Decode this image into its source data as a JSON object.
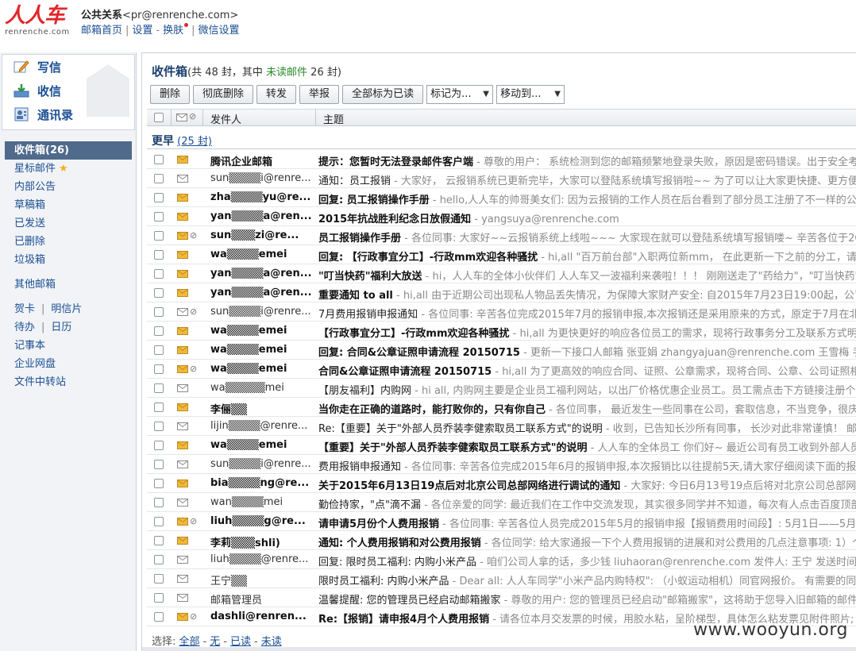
{
  "header": {
    "logo_text": "人人车",
    "logo_sub": "renrenche.com",
    "account_name": "公共关系",
    "account_email": "<pr@renrenche.com>",
    "links": [
      "邮箱首页",
      "设置",
      "换肤",
      "微信设置"
    ]
  },
  "sidebar": {
    "compose": "写信",
    "receive": "收信",
    "contacts": "通讯录",
    "folders": {
      "inbox": "收件箱(26)",
      "starred": "星标邮件",
      "notice": "内部公告",
      "drafts": "草稿箱",
      "sent": "已发送",
      "deleted": "已删除",
      "spam": "垃圾箱",
      "other": "其他邮箱",
      "card": "贺卡",
      "postcard": "明信片",
      "todo": "待办",
      "calendar": "日历",
      "notes": "记事本",
      "netdisk": "企业网盘",
      "transfer": "文件中转站"
    }
  },
  "main": {
    "title": "收件箱",
    "count_prefix": "(共 48 封，其中 ",
    "unread_label": "未读邮件",
    "count_suffix": " 26 封)",
    "toolbar": {
      "delete": "删除",
      "delete_forever": "彻底删除",
      "forward": "转发",
      "report": "举报",
      "mark_all_read": "全部标为已读",
      "mark_as": "标记为...",
      "move_to": "移动到..."
    },
    "columns": {
      "sender": "发件人",
      "subject": "主题"
    },
    "group": {
      "label": "更早",
      "count": "(25 封)"
    },
    "emails": [
      {
        "from": "腾讯企业邮箱",
        "subject": "提示：您暂时无法登录邮件客户端",
        "preview": " - 尊敬的用户： 系统检测到您的邮箱频繁地登录失败，原因是密码错误。出于安全考虑，您",
        "unread": true,
        "attach": false,
        "blue": true
      },
      {
        "from": "sun▒▒▒▒i@renre...",
        "subject": "通知：员工报销",
        "preview": " - 大家好， 云报销系统已更新完毕，大家可以登陆系统填写报销啦~~ 为了可以让大家更快捷、更方便的申请报",
        "unread": false,
        "attach": false
      },
      {
        "from": "zha▒▒▒▒yu@re...",
        "subject": "回复: 员工报销操作手册",
        "preview": " - hello,人人车的帅哥美女们: 因为云报销的工作人员在后台看到了部分员工注册了不一样的公司名称",
        "unread": true,
        "attach": false
      },
      {
        "from": "yan▒▒▒▒a@ren...",
        "subject": "2015年抗战胜利纪念日放假通知",
        "preview": " - yangsuya@renrenche.com",
        "unread": true,
        "attach": false
      },
      {
        "from": "sun▒▒▒zi@re...",
        "subject": "员工报销操作手册",
        "preview": " - 各位同事: 大家好~~云报销系统上线啦~~~ 大家现在就可以登陆系统填写报销喽~ 辛苦各位于2015.0",
        "unread": true,
        "attach": true
      },
      {
        "from": "wa▒▒▒▒emei",
        "subject": "回复: 【行政事宜分工】-行政mm欢迎各种骚扰",
        "preview": " - hi,all \"百万前台部\"入职两位新mm， 在此更新一下之前的分工，请相关",
        "unread": true,
        "attach": false
      },
      {
        "from": "yan▒▒▒▒a@ren...",
        "subject": "\"叮当快药\"福利大放送",
        "preview": " - hi，人人车的全体小伙伴们 人人车又一波福利来袭啦！！！ 刚刚送走了\"药给力\"，\"叮当快药\"又来给",
        "unread": true,
        "attach": false
      },
      {
        "from": "yan▒▒▒▒a@ren...",
        "subject": "重要通知 to all",
        "preview": " - hi,all 由于近期公司出现私人物品丢失情况，为保障大家财产安全: 自2015年7月23日19:00起，公司将随",
        "unread": true,
        "attach": false
      },
      {
        "from": "sun▒▒▒▒i@renre...",
        "subject": "7月费用报销申报通知",
        "preview": " - 各位同事: 辛苦各位完成2015年7月的报销申报,本次报销还是采用原来的方式，原定于7月在北京上线",
        "unread": false,
        "attach": true
      },
      {
        "from": "wa▒▒▒▒emei",
        "subject": "【行政事宜分工】-行政mm欢迎各种骚扰",
        "preview": " - hi,all 为更快更好的响应各位员工的需求，现将行政事务分工及联系方式明确如下",
        "unread": true,
        "attach": false
      },
      {
        "from": "wa▒▒▒▒emei",
        "subject": "回复: 合同&公章证照申请流程 20150715",
        "preview": " - 更新一下接口人邮箱 张亚娟 zhangyajuan@renrenche.com 王雪梅 手机：1",
        "unread": true,
        "attach": false
      },
      {
        "from": "wa▒▒▒▒emei",
        "subject": "合同&公章证照申请流程 20150715",
        "preview": " - hi,all 为了更高效的响应合同、证照、公章需求，现将合同、公章、公司证照相关申请",
        "unread": true,
        "attach": true
      },
      {
        "from": "wa▒▒▒▒▒mei",
        "subject": "【朋友福利】内购网",
        "preview": " - hi all, 内购网主要是企业员工福利网站，以出厂价格优惠企业员工。员工需点击下方链接注册个人账号，",
        "unread": false,
        "attach": false
      },
      {
        "from": "李俪▒▒",
        "subject": "当你走在正确的道路时，能打败你的，只有你自己",
        "preview": " - 各位同事， 最近发生一些同事在公司，套取信息，不当竞争，很庆幸我们",
        "unread": true,
        "attach": false
      },
      {
        "from": "lijin▒▒▒▒@renre...",
        "subject": "Re:【重要】关于\"外部人员乔装李健索取员工联系方式\"的说明",
        "preview": " - 收到，已告知长沙所有同事， 长沙对此非常谨慎！ 邮件自认",
        "unread": false,
        "attach": false
      },
      {
        "from": "wa▒▒▒▒emei",
        "subject": "【重要】关于\"外部人员乔装李健索取员工联系方式\"的说明",
        "preview": " - 人人车的全体员工 你们好~ 最近公司有员工收到外部人员邮件",
        "unread": true,
        "attach": false
      },
      {
        "from": "sun▒▒▒▒i@renre...",
        "subject": "费用报销申报通知",
        "preview": " - 各位同事: 辛苦各位完成2015年6月的报销申报,本次报销比以往提前5天,请大家仔细阅读下面的报销说明",
        "unread": false,
        "attach": false
      },
      {
        "from": "bia▒▒▒▒ng@re...",
        "subject": "关于2015年6月13日19点后对北京公司总部网络进行调试的通知",
        "preview": " - 大家好: 今日6月13号19点后将对北京公司总部网络",
        "unread": true,
        "attach": false
      },
      {
        "from": "wan▒▒▒▒mei",
        "subject": "勤俭持家，\"点\"滴不漏",
        "preview": " - 各位亲爱的同学: 最近我们在工作中交流发现，其实很多同学并不知道，每次有人点击百度顶部的人人车",
        "unread": false,
        "attach": false
      },
      {
        "from": "liuh▒▒▒▒g@re...",
        "subject": "请申请5月份个人费用报销",
        "preview": " - 各位同事: 辛苦各位人员完成2015年5月的报销申报【报销费用时间段】: 5月1日——5月31日",
        "unread": true,
        "attach": true
      },
      {
        "from": "李莉▒▒▒shli)",
        "subject": "通知: 个人费用报销和对公费用报销",
        "preview": " - 各位同学: 给大家通报一下个人费用报销的进展和对公费用的几点注意事项: 1）个",
        "unread": true,
        "attach": false
      },
      {
        "from": "liuh▒▒▒▒@renre...",
        "subject": "回复: 限时员工福利: 内购小米产品",
        "preview": " - 咱们公司人拿的话，多少钱 liuhaoran@renrenche.com 发件人: 王宁 发送时间: 2015",
        "unread": false,
        "attach": false
      },
      {
        "from": "王宁▒▒",
        "subject": "限时员工福利: 内购小米产品",
        "preview": " - Dear all: 人人车同学\"小米产品内购特权\": （小蚁运动相机）同官网报价。 有需要的同事请在",
        "unread": false,
        "attach": false
      },
      {
        "from": "邮箱管理员",
        "subject": "温馨提醒: 您的管理员已经启动邮箱搬家",
        "preview": " - 尊敬的用户: 您的管理员已经启动\"邮箱搬家\"，这将助于您导入旧邮箱的邮件。 您可以",
        "unread": false,
        "attach": false
      },
      {
        "from": "dashli@renren...",
        "subject": "Re:【报销】请申报4月个人费用报销",
        "preview": " - 请各位本月交发票的时候，用胶水粘，呈阶梯型，具体怎么粘发票见附件照片; 如用",
        "unread": true,
        "attach": true
      }
    ],
    "footer": {
      "select": "选择:",
      "all": "全部",
      "none": "无",
      "read": "已读",
      "unread": "未读"
    }
  },
  "watermark": "www.wooyun.org",
  "colors": {
    "brand": "#e2262b",
    "link": "#1b4f93",
    "active_folder": "#4f6a8b",
    "unread_green": "#2a8a2a",
    "envelope_unread": "#f0b93a"
  }
}
